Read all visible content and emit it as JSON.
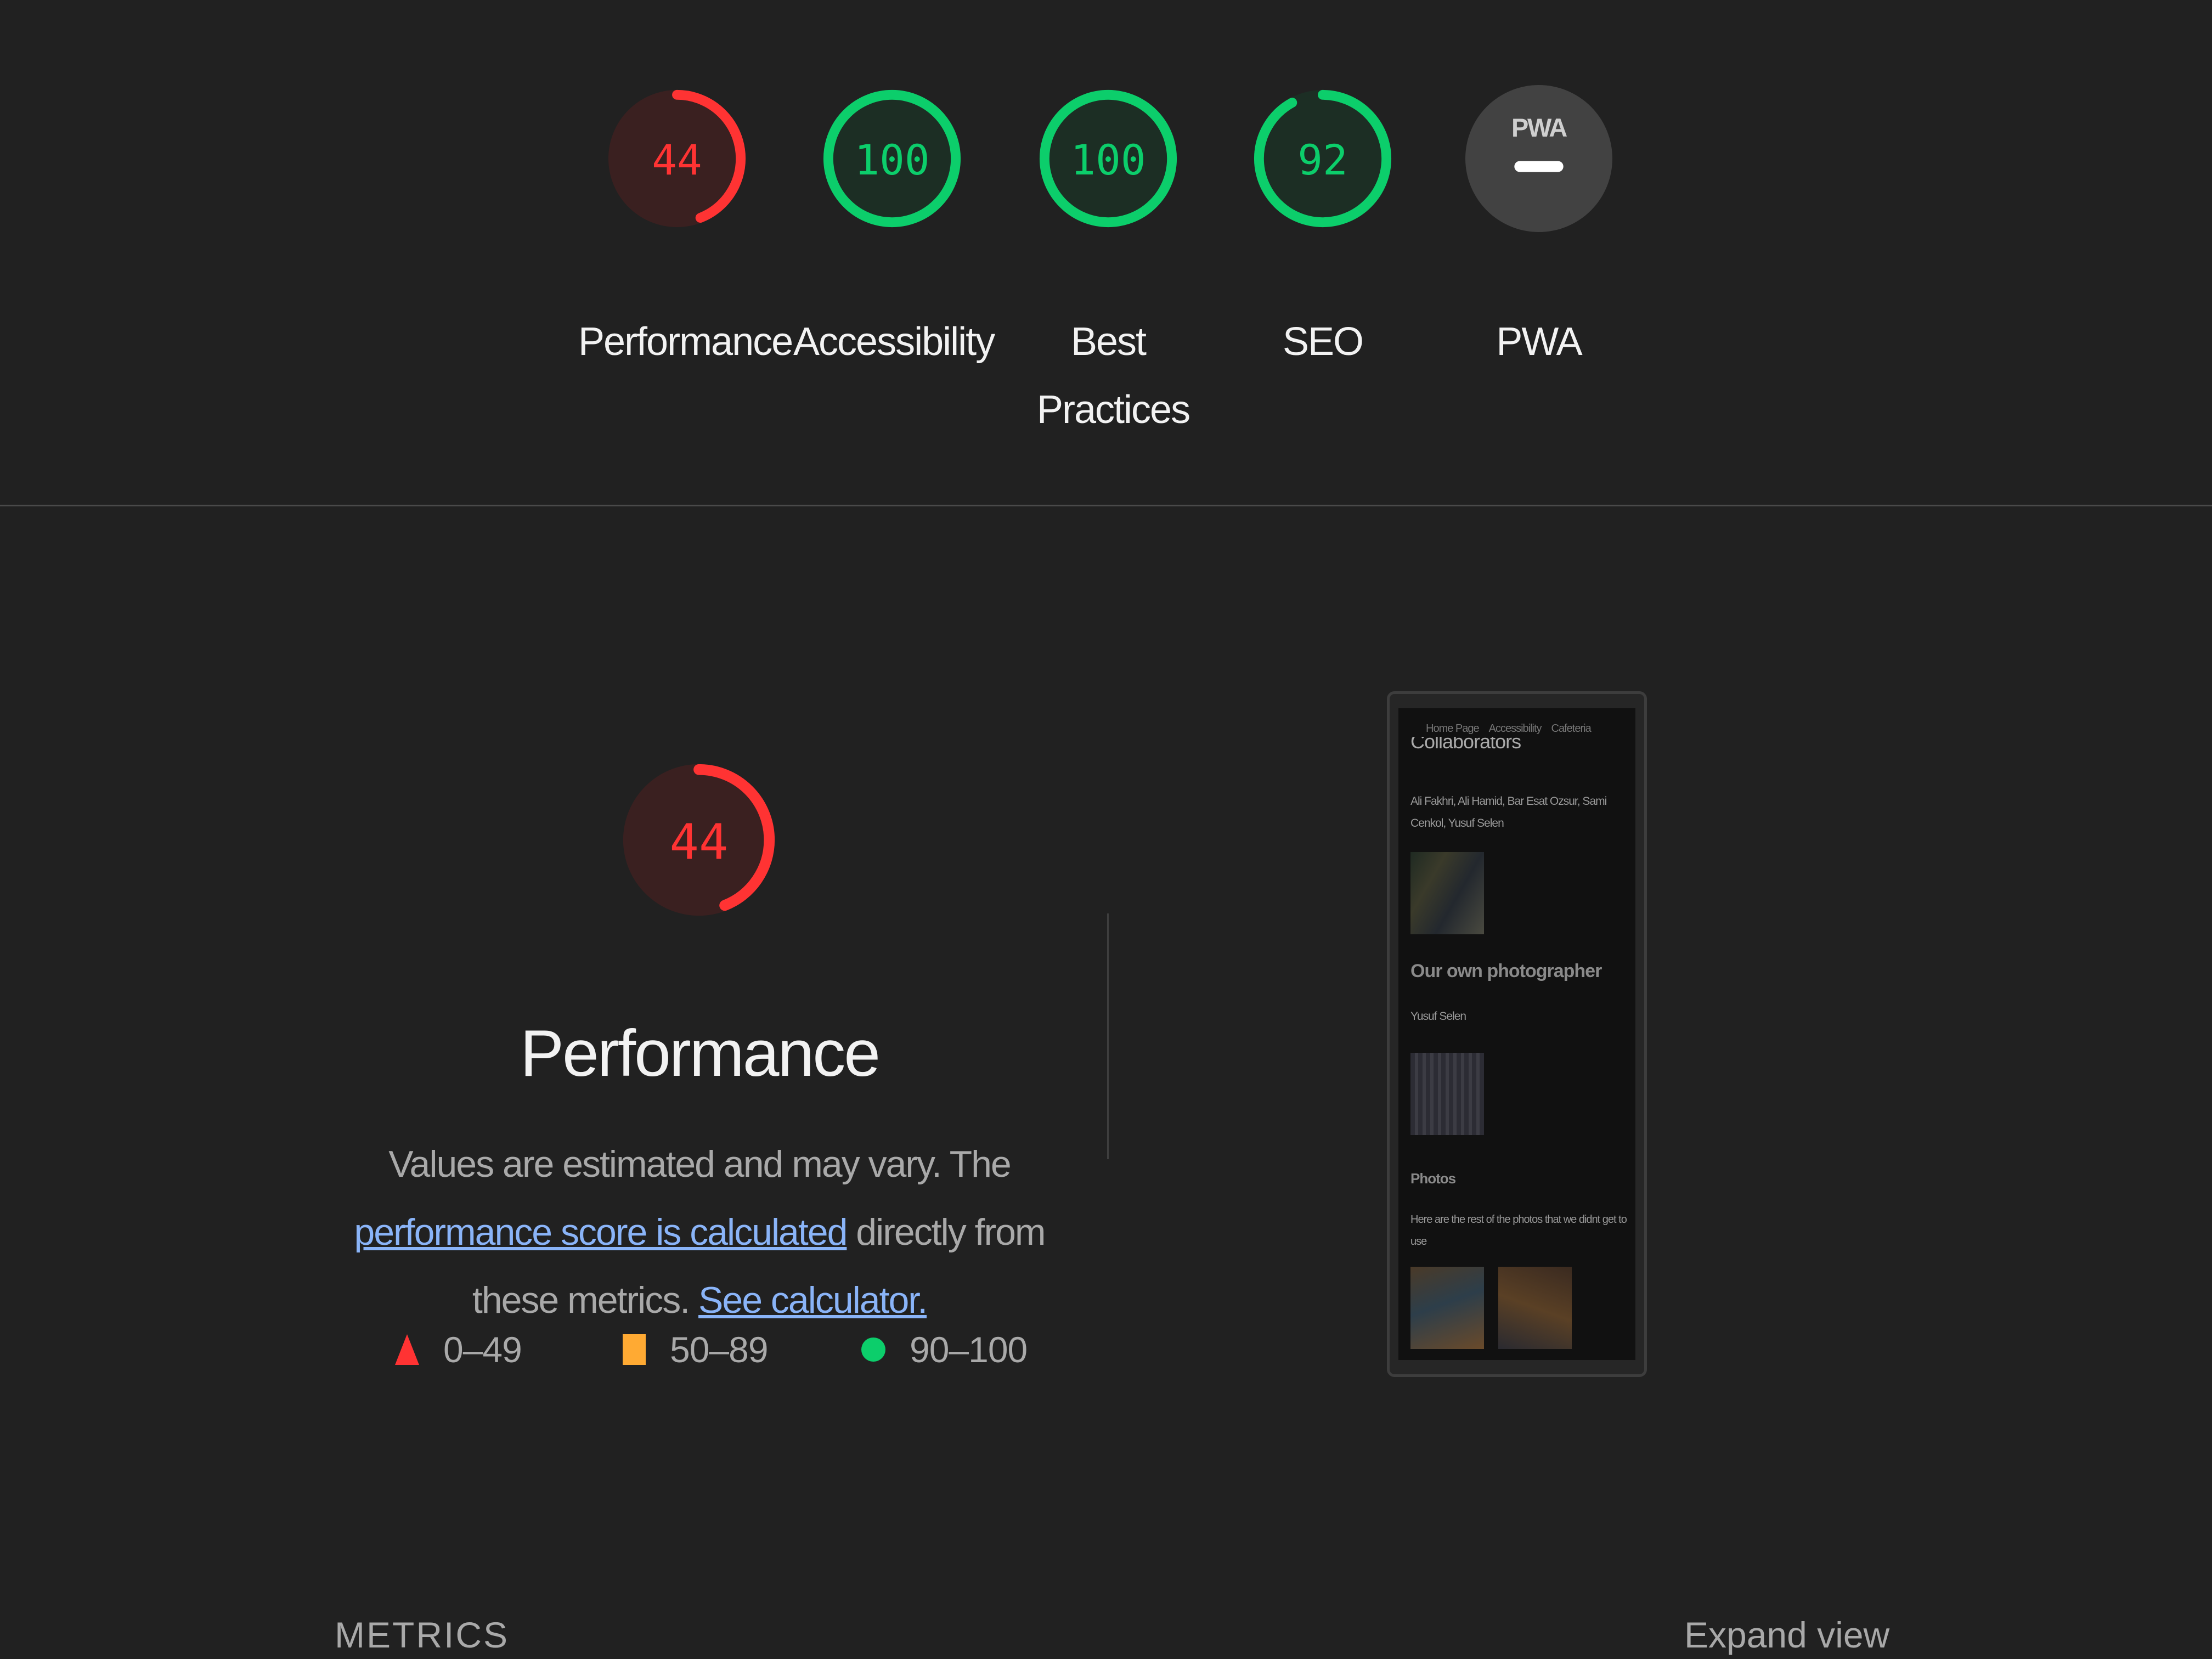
{
  "colors": {
    "background": "#212121",
    "fail": "#ff3333",
    "average": "#ffaa33",
    "pass": "#0cce6b",
    "link": "#8ab4f8",
    "na_gauge": "#424242"
  },
  "gauges": [
    {
      "score": "44",
      "value": 44,
      "status": "fail",
      "label": "Performance"
    },
    {
      "score": "100",
      "value": 100,
      "status": "pass",
      "label": "Accessibility"
    },
    {
      "score": "100",
      "value": 100,
      "status": "pass",
      "label": "Best Practices"
    },
    {
      "score": "92",
      "value": 92,
      "status": "pass",
      "label": "SEO"
    },
    {
      "score": "PWA",
      "value": null,
      "status": "na",
      "label": "PWA"
    }
  ],
  "performance": {
    "score": "44",
    "value": 44,
    "title": "Performance",
    "desc_part1": "Values are estimated and may vary. The ",
    "link1": "performance score is calculated",
    "desc_part2": " directly from these metrics. ",
    "link2": "See calculator."
  },
  "legend": [
    {
      "icon": "triangle",
      "range": "0–49"
    },
    {
      "icon": "square",
      "range": "50–89"
    },
    {
      "icon": "circle",
      "range": "90–100"
    }
  ],
  "screenshot": {
    "nav": [
      "Home Page",
      "Accessibility",
      "Cafeteria"
    ],
    "heading1": "Collaborators",
    "names1": "Ali Fakhri, Ali Hamid, Bar Esat Ozsur, Sami Cenkol, Yusuf Selen",
    "heading2": "Our own photographer",
    "names2": "Yusuf Selen",
    "heading3": "Photos",
    "text3": "Here are the rest of the photos that we didnt get to use"
  },
  "metrics": {
    "label": "METRICS",
    "expand": "Expand view"
  }
}
